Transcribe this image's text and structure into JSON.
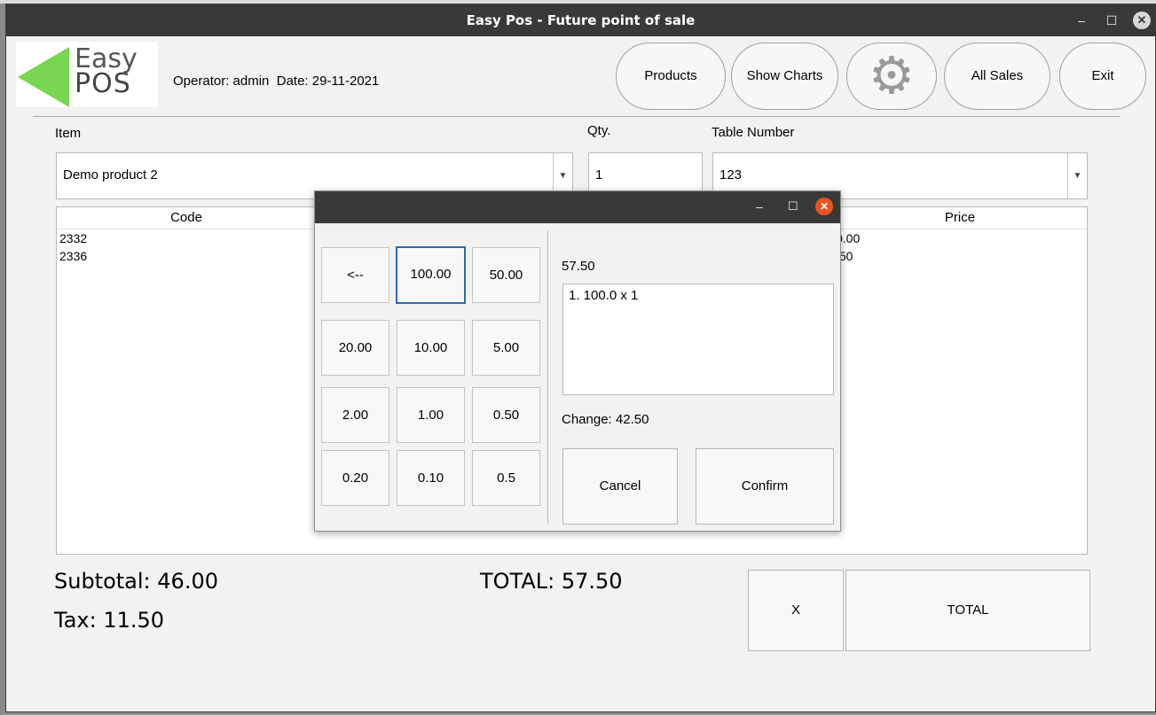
{
  "window": {
    "title": "Easy Pos - Future point of sale",
    "min_icon": "–",
    "max_icon": "☐",
    "close_icon": "✕"
  },
  "logo": {
    "line1": "Easy",
    "line2": "POS"
  },
  "header": {
    "operator_label": "Operator: admin",
    "date_label": "Date: 29-11-2021"
  },
  "nav": {
    "products": "Products",
    "show_charts": "Show Charts",
    "settings_icon": "⚙",
    "all_sales": "All Sales",
    "exit": "Exit"
  },
  "form": {
    "item_label": "Item",
    "item_value": "Demo product 2",
    "qty_label": "Qty.",
    "qty_value": "1",
    "table_label": "Table Number",
    "table_value": "123",
    "dropdown_icon": "▼"
  },
  "table": {
    "columns": {
      "code": "Code",
      "price": "Price"
    },
    "rows": [
      {
        "code": "2332",
        "price": "0.00"
      },
      {
        "code": "2336",
        "price": ".50"
      }
    ]
  },
  "totals": {
    "subtotal": "Subtotal: 46.00",
    "tax": "Tax: 11.50",
    "total": "TOTAL: 57.50"
  },
  "actions": {
    "clear": "X",
    "total": "TOTAL"
  },
  "payment_dialog": {
    "keys": [
      "<--",
      "100.00",
      "50.00",
      "20.00",
      "10.00",
      "5.00",
      "2.00",
      "1.00",
      "0.50",
      "0.20",
      "0.10",
      "0.5"
    ],
    "amount_due": "57.50",
    "entries": [
      "1. 100.0  x   1"
    ],
    "change": "Change: 42.50",
    "cancel": "Cancel",
    "confirm": "Confirm",
    "min_icon": "–",
    "max_icon": "☐",
    "close_icon": "✕",
    "close_color": "#e95420"
  },
  "colors": {
    "titlebar": "#3a3937",
    "logo_green": "#78d651",
    "focus_border": "#2a6ab5"
  }
}
